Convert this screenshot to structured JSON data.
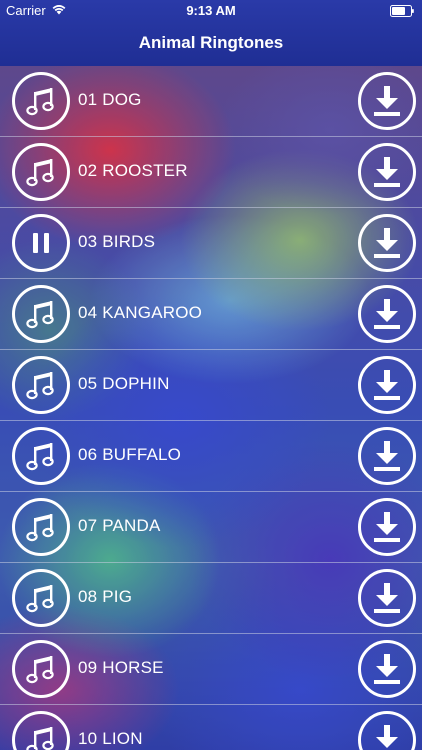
{
  "status_bar": {
    "carrier": "Carrier",
    "time": "9:13 AM"
  },
  "header": {
    "title": "Animal Ringtones"
  },
  "colors": {
    "header_bg": "#2a3aa8",
    "text": "#ffffff"
  },
  "tracks": [
    {
      "label": "01 DOG",
      "state": "idle",
      "play_icon": "music-note-icon",
      "download_icon": "download-icon"
    },
    {
      "label": "02 ROOSTER",
      "state": "idle",
      "play_icon": "music-note-icon",
      "download_icon": "download-icon"
    },
    {
      "label": "03 BIRDS",
      "state": "playing",
      "play_icon": "pause-icon",
      "download_icon": "download-icon"
    },
    {
      "label": "04 KANGAROO",
      "state": "idle",
      "play_icon": "music-note-icon",
      "download_icon": "download-icon"
    },
    {
      "label": "05 DOPHIN",
      "state": "idle",
      "play_icon": "music-note-icon",
      "download_icon": "download-icon"
    },
    {
      "label": "06 BUFFALO",
      "state": "idle",
      "play_icon": "music-note-icon",
      "download_icon": "download-icon"
    },
    {
      "label": "07 PANDA",
      "state": "idle",
      "play_icon": "music-note-icon",
      "download_icon": "download-icon"
    },
    {
      "label": "08 PIG",
      "state": "idle",
      "play_icon": "music-note-icon",
      "download_icon": "download-icon"
    },
    {
      "label": "09 HORSE",
      "state": "idle",
      "play_icon": "music-note-icon",
      "download_icon": "download-icon"
    },
    {
      "label": "10 LION",
      "state": "idle",
      "play_icon": "music-note-icon",
      "download_icon": "download-icon"
    }
  ]
}
